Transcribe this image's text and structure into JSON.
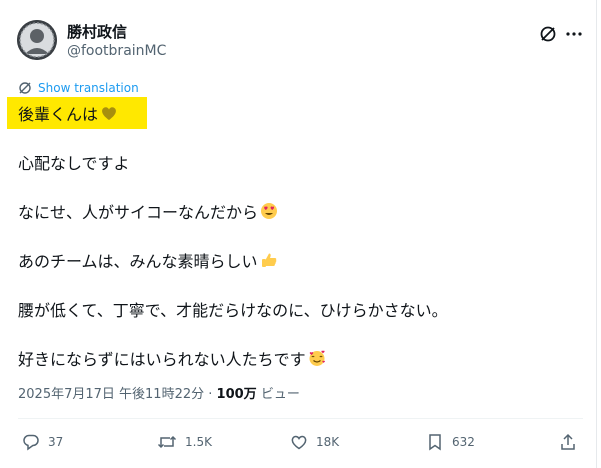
{
  "author": {
    "display_name": "勝村政信",
    "handle": "@footbrainMC",
    "avatar_icon": "avatar-photo"
  },
  "header_icons": [
    "grok-icon",
    "more-icon"
  ],
  "translation": {
    "label": "Show translation",
    "icon": "translate-icon"
  },
  "post": {
    "lines": [
      "後輩くんは",
      "心配なしですよ",
      "なにせ、人がサイコーなんだから",
      "あのチームは、みんな素晴らしい",
      "腰が低くて、丁寧で、才能だらけなのに、ひけらかさない。",
      "好きにならずにはいられない人たちです"
    ],
    "emojis": [
      "yellow-heart",
      "heart-eyes",
      "thumbs-up",
      "smiling-face-with-hearts"
    ],
    "highlight_color": "#ffe800"
  },
  "meta": {
    "timestamp": "2025年7月17日 午後11時22分",
    "separator": "·",
    "views_count": "100万",
    "views_label": "ビュー"
  },
  "actions": {
    "reply": "37",
    "repost": "1.5K",
    "like": "18K",
    "bookmark": "632"
  },
  "colors": {
    "accent": "#1d9bf0",
    "secondary_text": "#536471"
  }
}
